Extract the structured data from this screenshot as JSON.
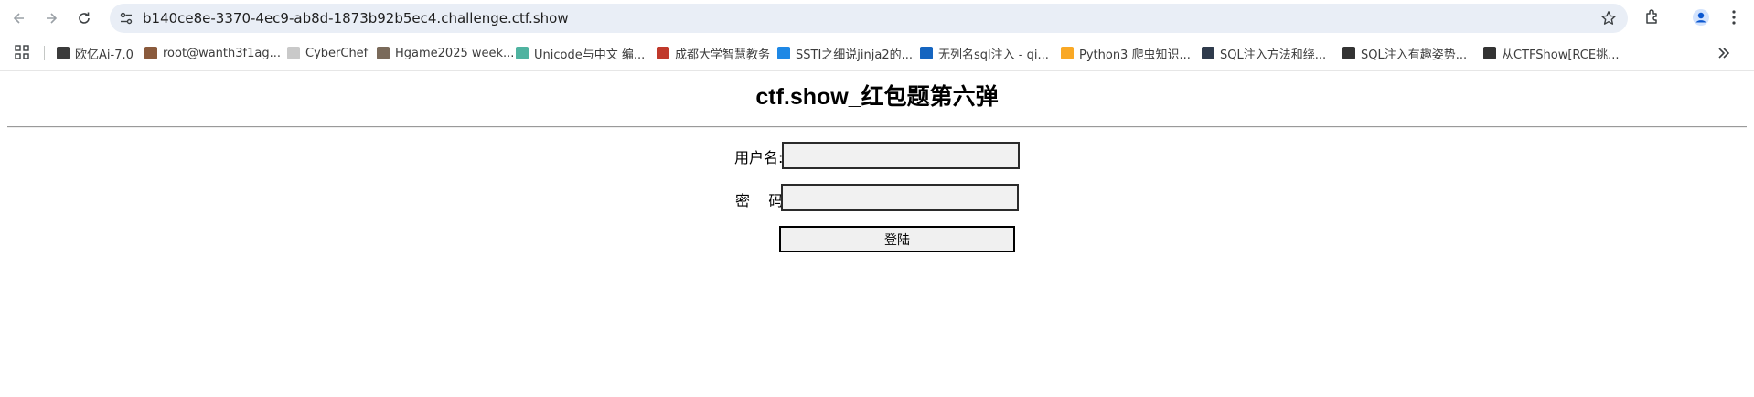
{
  "browser": {
    "url": "b140ce8e-3370-4ec9-ab8d-1873b92b5ec4.challenge.ctf.show",
    "icons": [
      "back-icon",
      "forward-icon",
      "reload-icon",
      "site-settings-icon",
      "bookmark-star-icon",
      "extensions-icon",
      "profile-icon",
      "menu-icon"
    ]
  },
  "bookmarks": [
    {
      "label": "欧亿Ai-7.0",
      "color": "#3b3b3b"
    },
    {
      "label": "root@wanth3f1ag...",
      "color": "#8a5a3c"
    },
    {
      "label": "CyberChef",
      "color": "#c9c9c9"
    },
    {
      "label": "Hgame2025 week...",
      "color": "#7a6a5a"
    },
    {
      "label": "Unicode与中文 编...",
      "color": "#4fb3a0"
    },
    {
      "label": "成都大学智慧教务",
      "color": "#c0392b"
    },
    {
      "label": "SSTI之细说jinja2的...",
      "color": "#1e88e5"
    },
    {
      "label": "无列名sql注入 - qi...",
      "color": "#1565c0"
    },
    {
      "label": "Python3 爬虫知识...",
      "color": "#f9a825"
    },
    {
      "label": "SQL注入方法和绕...",
      "color": "#2f3b4c"
    },
    {
      "label": "SQL注入有趣姿势...",
      "color": "#333333"
    },
    {
      "label": "从CTFShow[RCE挑...",
      "color": "#333333"
    }
  ],
  "page": {
    "title": "ctf.show_红包题第六弹",
    "username_label": "用户名:",
    "password_label": "密    码:",
    "username_value": "",
    "password_value": "",
    "login_label": "登陆"
  }
}
